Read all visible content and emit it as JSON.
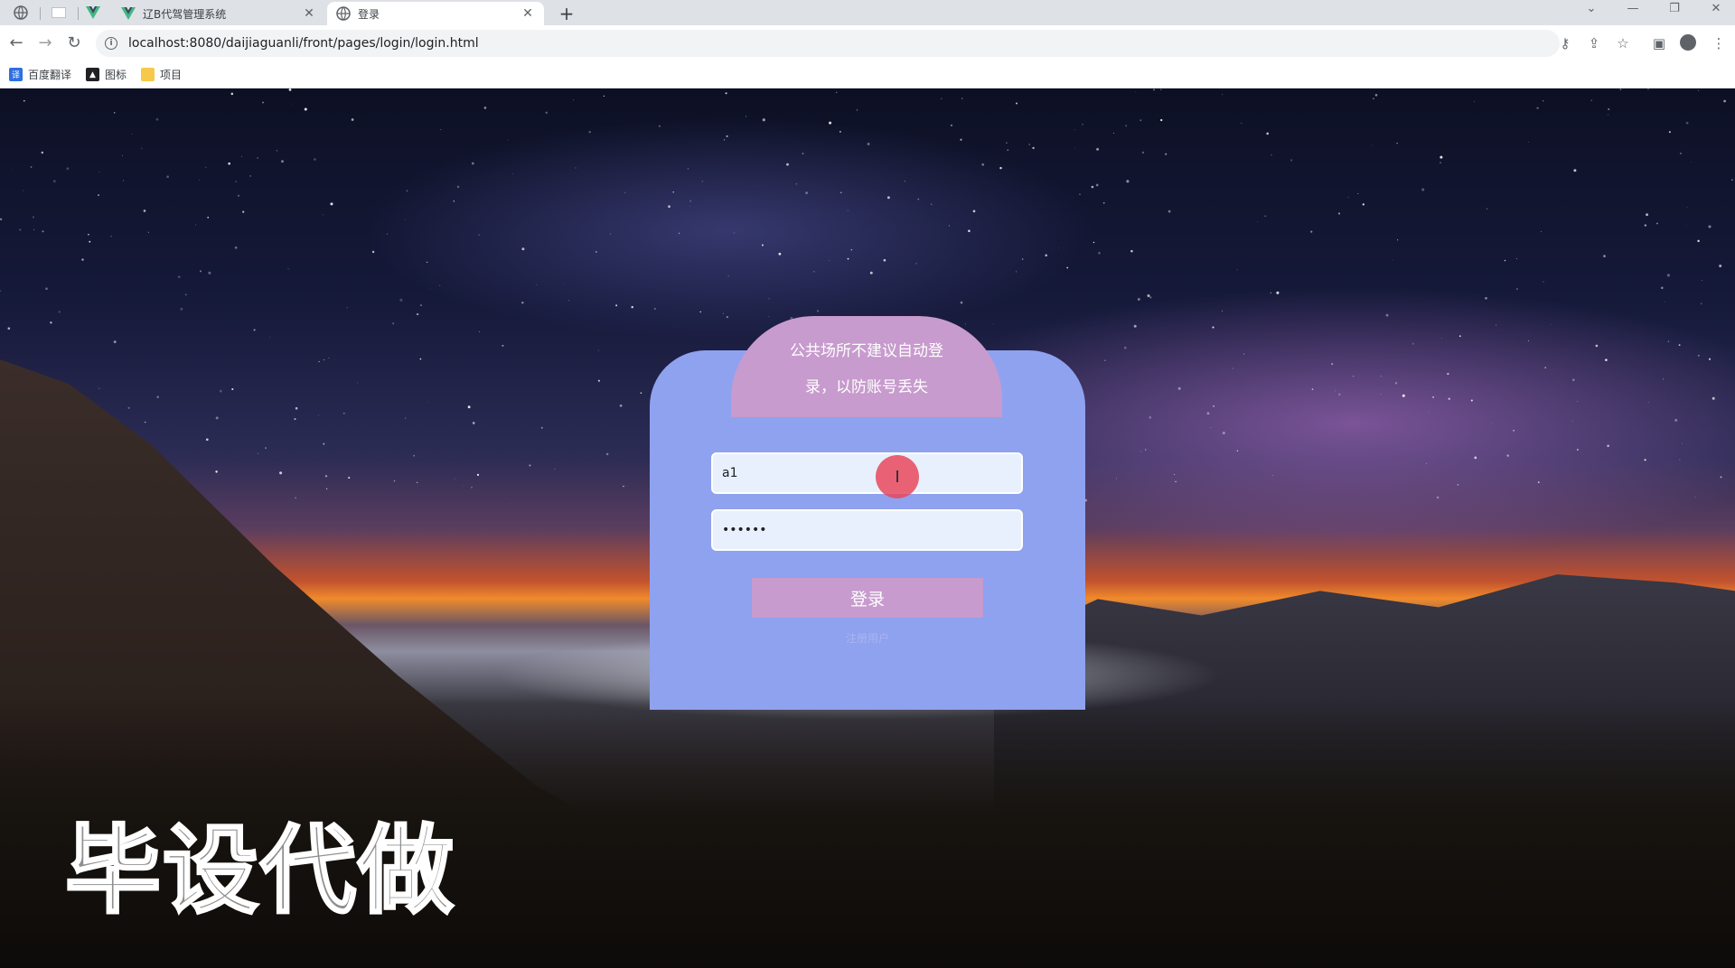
{
  "browser": {
    "tabs": [
      {
        "title": "辽B代驾管理系统",
        "close": "✕"
      },
      {
        "title": "登录",
        "close": "✕"
      }
    ],
    "new_tab": "+",
    "url": "localhost:8080/daijiaguanli/front/pages/login/login.html",
    "bookmarks": [
      {
        "label": "百度翻译",
        "icon": "translate-icon",
        "color": "#2f6fe0"
      },
      {
        "label": "图标",
        "icon": "picture-icon",
        "color": "#202124"
      },
      {
        "label": "项目",
        "icon": "folder-icon",
        "color": "#f6c94c"
      }
    ]
  },
  "login": {
    "notice_line1": "公共场所不建议自动登",
    "notice_line2": "录，以防账号丢失",
    "username_value": "a1",
    "password_value": "••••••",
    "submit_label": "登录",
    "register_label": "注册用户"
  },
  "watermark": "毕设代做",
  "colors": {
    "card": "#8fa2ef",
    "accent": "#c79bcd",
    "cursor": "#e8485c"
  }
}
